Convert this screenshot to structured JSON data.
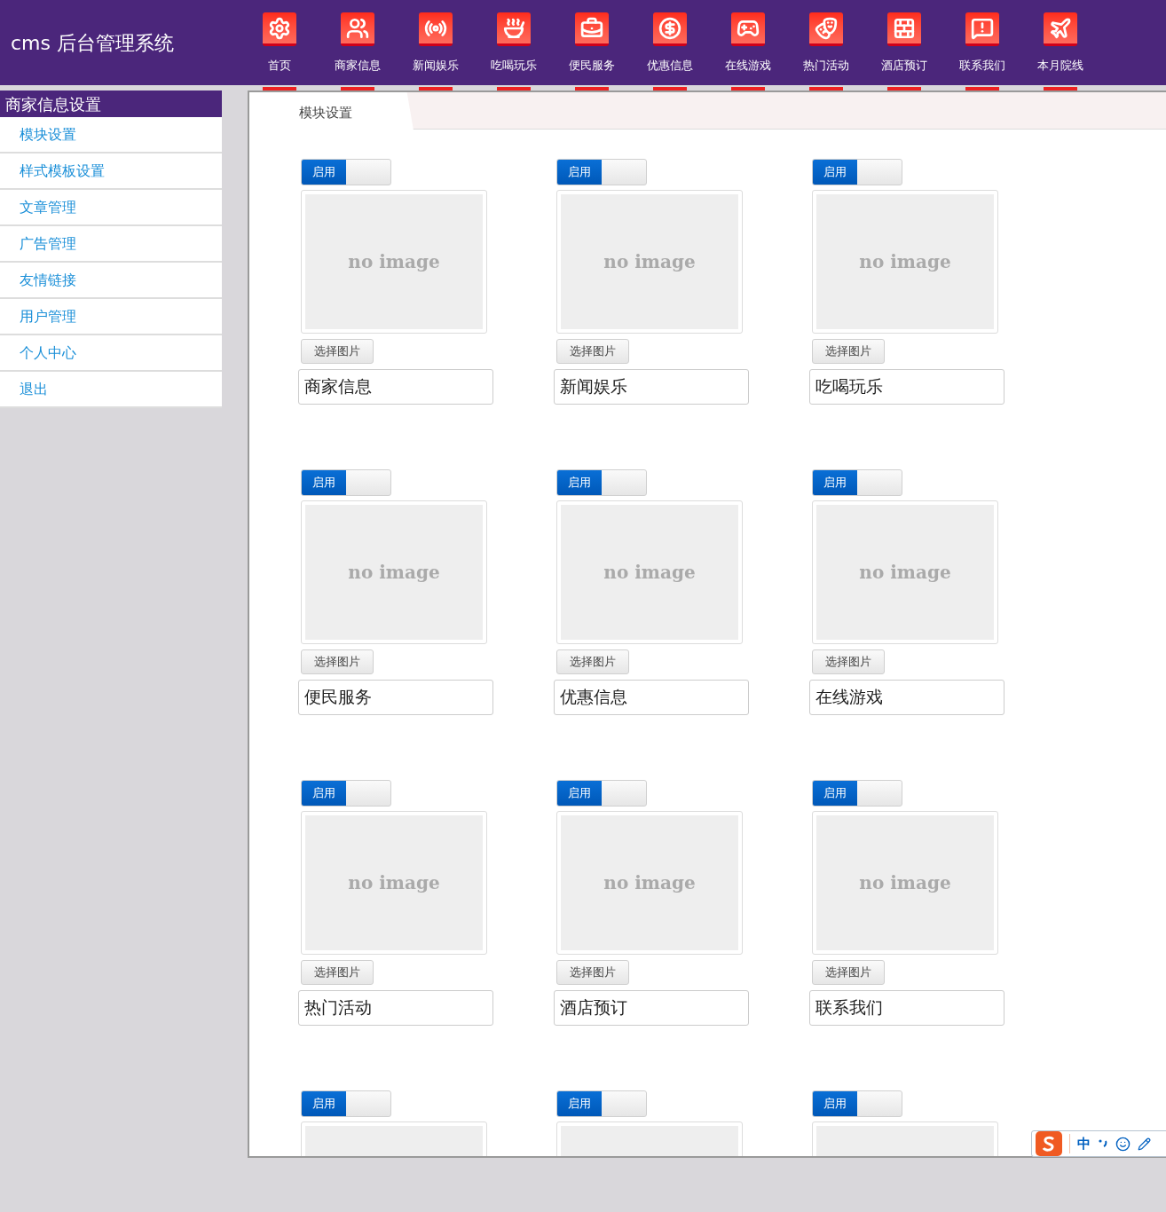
{
  "header": {
    "title": "cms 后台管理系统",
    "nav": [
      {
        "label": "首页"
      },
      {
        "label": "商家信息"
      },
      {
        "label": "新闻娱乐"
      },
      {
        "label": "吃喝玩乐"
      },
      {
        "label": "便民服务"
      },
      {
        "label": "优惠信息"
      },
      {
        "label": "在线游戏"
      },
      {
        "label": "热门活动"
      },
      {
        "label": "酒店预订"
      },
      {
        "label": "联系我们"
      },
      {
        "label": "本月院线"
      }
    ]
  },
  "sidebar": {
    "heading": "商家信息设置",
    "items": [
      {
        "label": "模块设置"
      },
      {
        "label": "样式模板设置"
      },
      {
        "label": "文章管理"
      },
      {
        "label": "广告管理"
      },
      {
        "label": "友情链接"
      },
      {
        "label": "用户管理"
      },
      {
        "label": "个人中心"
      },
      {
        "label": "退出"
      }
    ]
  },
  "tabs": [
    {
      "label": "模块设置",
      "selected": true
    }
  ],
  "modules": [
    {
      "toggle": {
        "label": "启用",
        "on": true
      },
      "image_text": "no image",
      "button": "选择图片",
      "name": "商家信息"
    },
    {
      "toggle": {
        "label": "启用",
        "on": true
      },
      "image_text": "no image",
      "button": "选择图片",
      "name": "新闻娱乐"
    },
    {
      "toggle": {
        "label": "启用",
        "on": true
      },
      "image_text": "no image",
      "button": "选择图片",
      "name": "吃喝玩乐"
    },
    {
      "toggle": {
        "label": "启用",
        "on": true
      },
      "image_text": "no image",
      "button": "选择图片",
      "name": "便民服务"
    },
    {
      "toggle": {
        "label": "启用",
        "on": true
      },
      "image_text": "no image",
      "button": "选择图片",
      "name": "优惠信息"
    },
    {
      "toggle": {
        "label": "启用",
        "on": true
      },
      "image_text": "no image",
      "button": "选择图片",
      "name": "在线游戏"
    },
    {
      "toggle": {
        "label": "启用",
        "on": true
      },
      "image_text": "no image",
      "button": "选择图片",
      "name": "热门活动"
    },
    {
      "toggle": {
        "label": "启用",
        "on": true
      },
      "image_text": "no image",
      "button": "选择图片",
      "name": "酒店预订"
    },
    {
      "toggle": {
        "label": "启用",
        "on": true
      },
      "image_text": "no image",
      "button": "选择图片",
      "name": "联系我们"
    },
    {
      "toggle": {
        "label": "启用",
        "on": true
      }
    },
    {
      "toggle": {
        "label": "启用",
        "on": true
      }
    },
    {
      "toggle": {
        "label": "启用",
        "on": true
      }
    }
  ],
  "ime_toolbar": {
    "mode": "中"
  }
}
